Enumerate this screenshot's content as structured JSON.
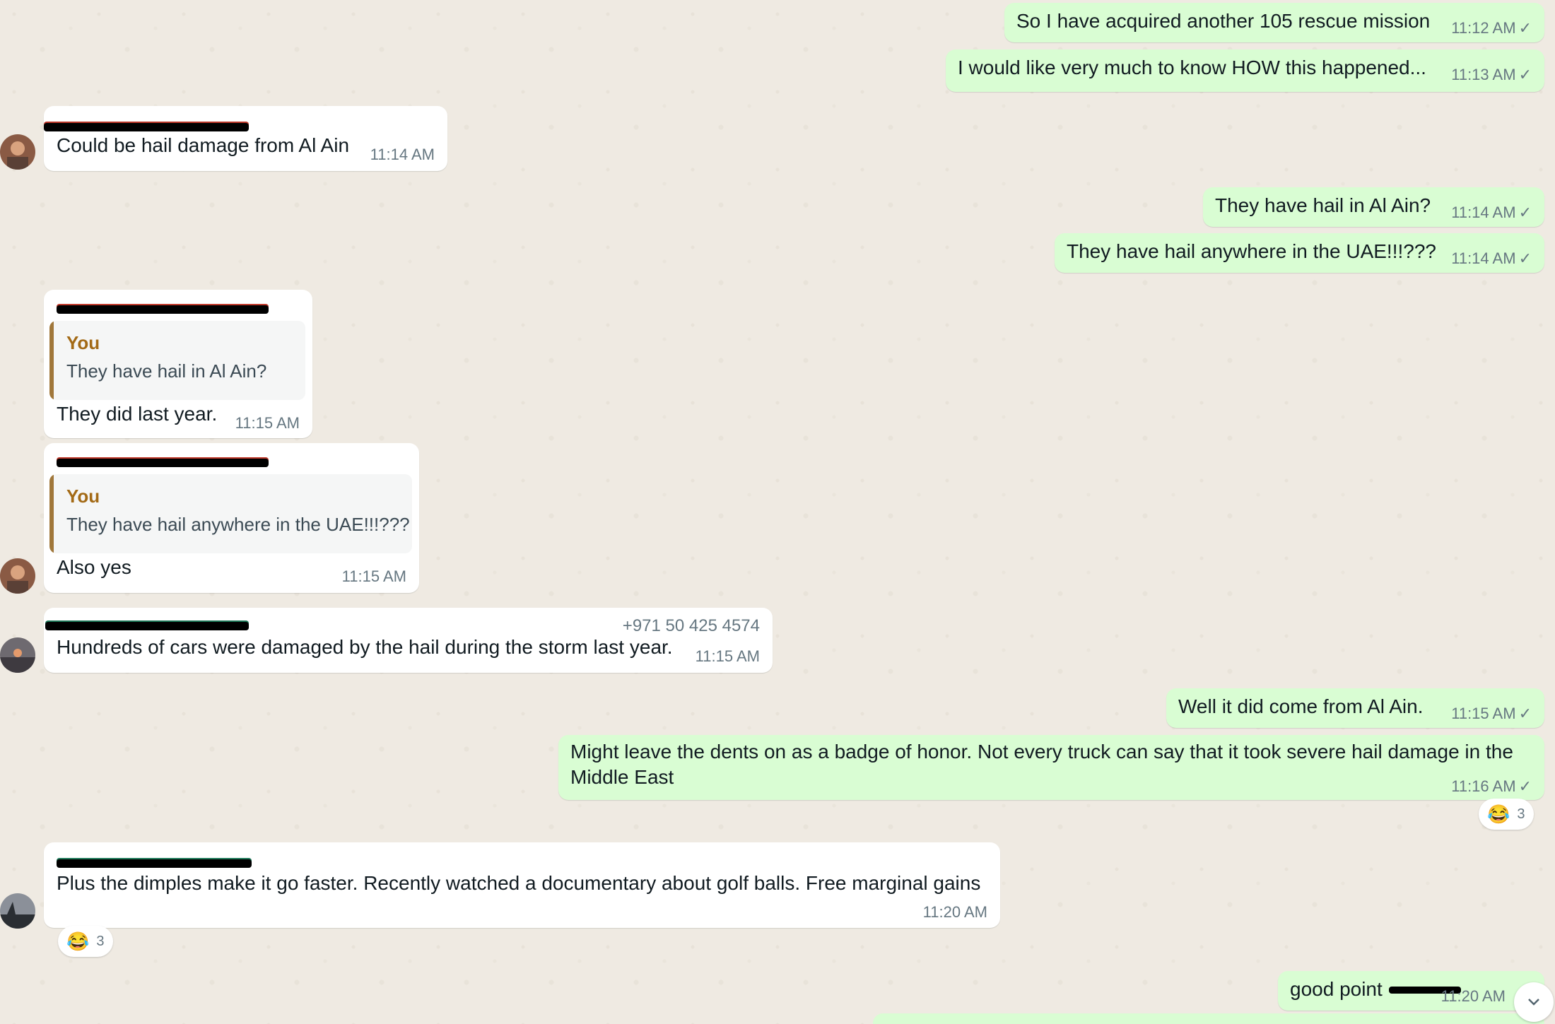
{
  "messages": [
    {
      "id": "m1",
      "text": "So I have acquired another 105 rescue mission",
      "time": "11:12 AM",
      "tick": "✓"
    },
    {
      "id": "m2",
      "text": "I would like very much to know HOW this happened...",
      "time": "11:13 AM",
      "tick": "✓"
    },
    {
      "id": "m3",
      "text": "Could be hail damage from Al Ain",
      "time": "11:14 AM"
    },
    {
      "id": "m4",
      "text": "They have hail in Al Ain?",
      "time": "11:14 AM",
      "tick": "✓"
    },
    {
      "id": "m5",
      "text": "They have hail anywhere in the UAE!!!???",
      "time": "11:14 AM",
      "tick": "✓"
    },
    {
      "id": "m6",
      "quote_author": "You",
      "quote_text": "They have hail in Al Ain?",
      "text": "They did last year.",
      "time": "11:15 AM"
    },
    {
      "id": "m7",
      "quote_author": "You",
      "quote_text": "They have hail anywhere in the UAE!!!???",
      "text": "Also yes",
      "time": "11:15 AM"
    },
    {
      "id": "m8",
      "phone": "+971 50 425 4574",
      "text": "Hundreds of cars were damaged by the hail during the storm last year.",
      "time": "11:15 AM"
    },
    {
      "id": "m9",
      "text": "Well it did come from Al Ain.",
      "time": "11:15 AM",
      "tick": "✓"
    },
    {
      "id": "m10",
      "text": "Might leave the dents on as a badge of honor.  Not every truck can say that it took severe hail damage in the Middle East",
      "time": "11:16 AM",
      "tick": "✓",
      "reaction": {
        "emoji": "😂",
        "count": "3"
      }
    },
    {
      "id": "m11",
      "text": "Plus the dimples make it go faster. Recently watched a documentary about golf balls. Free marginal gains",
      "time": "11:20 AM",
      "reaction": {
        "emoji": "😂",
        "count": "3"
      }
    },
    {
      "id": "m12",
      "text": "good point",
      "time": "11:20 AM"
    }
  ],
  "colors": {
    "outgoing": "#d9fdd3",
    "incoming": "#ffffff",
    "background": "#efeae2",
    "sender_red": "#c0392b",
    "sender_green": "#1f7a5a",
    "quote_author": "#a36a16"
  },
  "icons": {
    "scroll_down": "chevron-down-icon",
    "read_tick": "check-icon"
  }
}
